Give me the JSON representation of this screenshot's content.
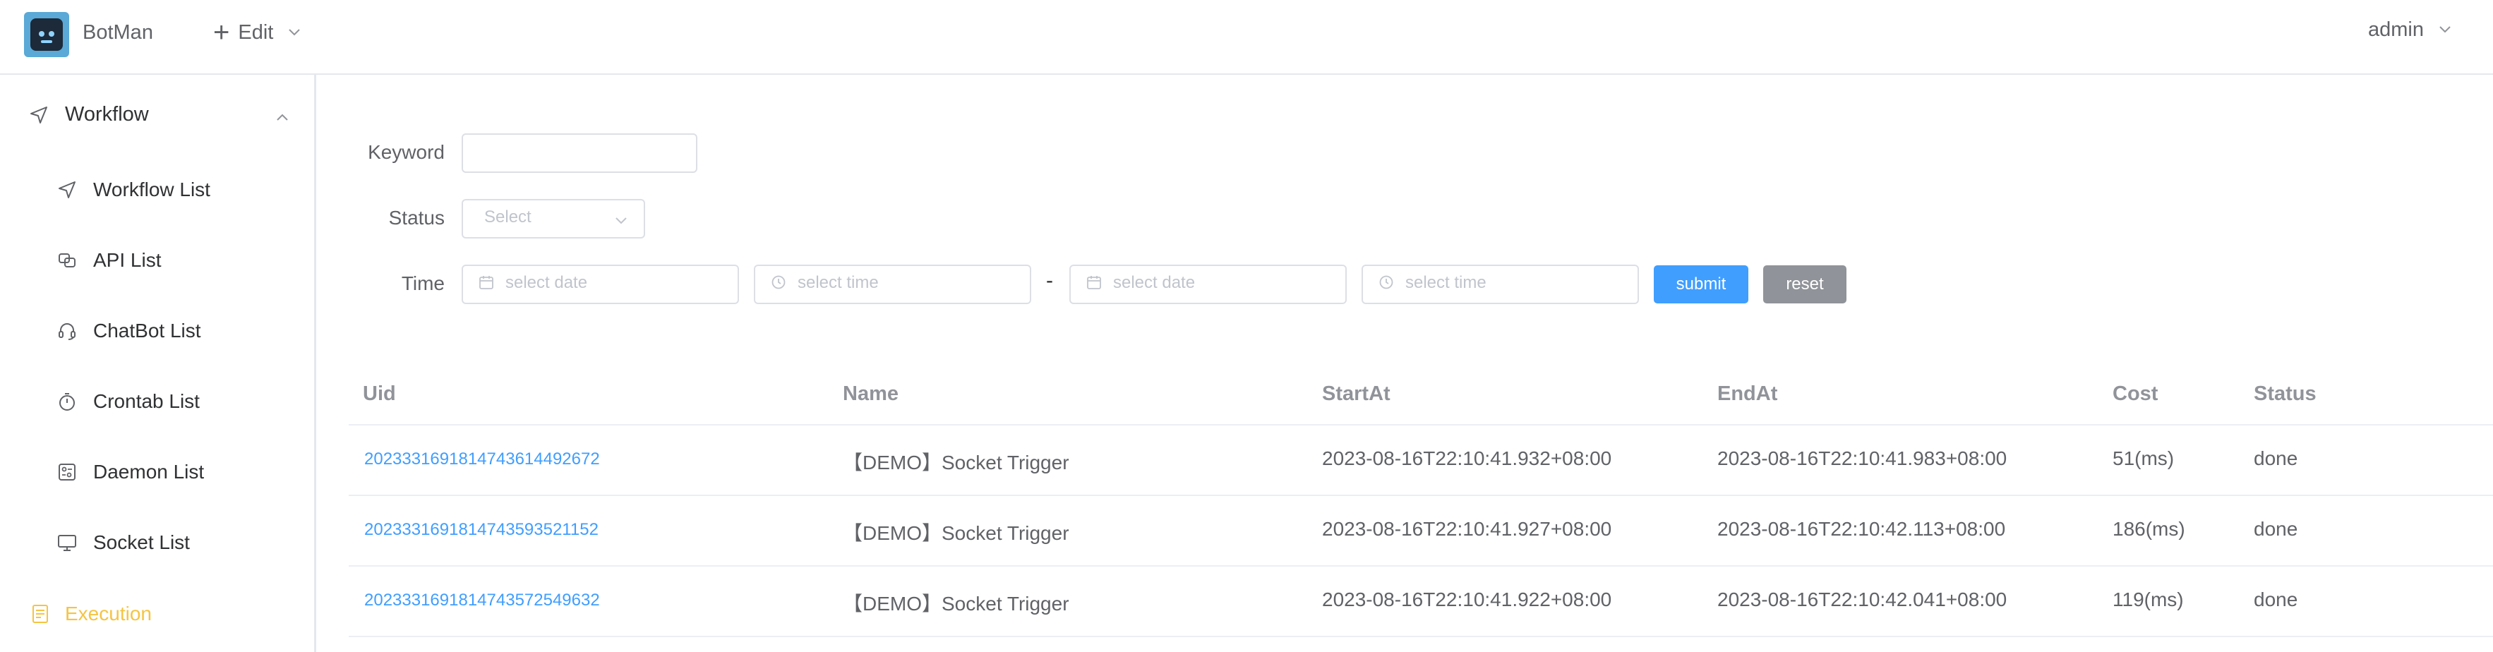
{
  "header": {
    "app_title": "BotMan",
    "edit_label": "Edit",
    "user_label": "admin"
  },
  "sidebar": {
    "group_label": "Workflow",
    "items": [
      {
        "label": "Workflow List",
        "icon": "send-icon"
      },
      {
        "label": "API List",
        "icon": "api-icon"
      },
      {
        "label": "ChatBot List",
        "icon": "headset-icon"
      },
      {
        "label": "Crontab List",
        "icon": "stopwatch-icon"
      },
      {
        "label": "Daemon List",
        "icon": "daemon-icon"
      },
      {
        "label": "Socket List",
        "icon": "monitor-icon"
      }
    ],
    "execution_label": "Execution",
    "execution_color": "#f5c443"
  },
  "filters": {
    "keyword_label": "Keyword",
    "keyword_value": "",
    "status_label": "Status",
    "status_placeholder": "Select",
    "time_label": "Time",
    "date_placeholder": "select date",
    "time_placeholder": "select time",
    "range_separator": "-",
    "submit_label": "submit",
    "reset_label": "reset",
    "submit_color": "#409eff",
    "reset_color": "#909399"
  },
  "table": {
    "columns": [
      "Uid",
      "Name",
      "StartAt",
      "EndAt",
      "Cost",
      "Status"
    ],
    "rows": [
      {
        "uid": "20233316918147436144926​72",
        "name": "【DEMO】Socket Trigger",
        "start": "2023-08-16T22:10:41.932+08:00",
        "end": "2023-08-16T22:10:41.983+08:00",
        "cost": "51(ms)",
        "status": "done"
      },
      {
        "uid": "202333169181474359352115​2",
        "name": "【DEMO】Socket Trigger",
        "start": "2023-08-16T22:10:41.927+08:00",
        "end": "2023-08-16T22:10:42.113+08:00",
        "cost": "186(ms)",
        "status": "done"
      },
      {
        "uid": "202333169181474357254963​2",
        "name": "【DEMO】Socket Trigger",
        "start": "2023-08-16T22:10:41.922+08:00",
        "end": "2023-08-16T22:10:42.041+08:00",
        "cost": "119(ms)",
        "status": "done"
      }
    ]
  }
}
